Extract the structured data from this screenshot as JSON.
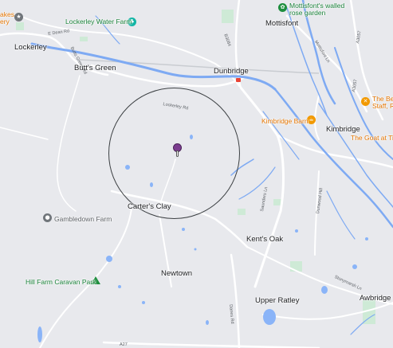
{
  "map": {
    "places": {
      "lockerley": "Lockerley",
      "butts_green": "Butt's Green",
      "dunbridge": "Dunbridge",
      "mottisfont": "Mottisfont",
      "kimbridge": "Kimbridge",
      "carters_clay": "Carter's Clay",
      "kents_oak": "Kent's Oak",
      "newtown": "Newtown",
      "upper_ratley": "Upper Ratley",
      "awbridge": "Awbridge"
    },
    "pois": {
      "lakes_line1": "akes",
      "lakes_line2": "ery",
      "lockerley_water_farm": "Lockerley Water Farm",
      "mottisfont_walled_line1": "Mottisfont's walled",
      "mottisfont_walled_line2": "rose garden",
      "kimbridge_barn": "Kimbridge Barn",
      "the_bea_line1": "The Bea",
      "the_bea_line2": "Staff, R",
      "goat_at_tin": "The Goat at Tin",
      "gambledown_farm": "Gambledown Farm",
      "hill_farm": "Hill Farm Caravan Park"
    },
    "roads": {
      "e_dean_rd": "E Dean Rd",
      "butts_green_rd": "Butts Green Rd",
      "lockerley_rd": "Lockerley Rd",
      "b3084": "B3084",
      "mottisfont_ln": "Mottisfont Ln",
      "a3057_top": "A3057",
      "a3057_right": "A3057",
      "saunders_ln": "Saunders Ln",
      "dunwood_hill": "Dunwood Hill",
      "danes_rd": "Danes Rd",
      "a27": "A27",
      "stonymarsh_ln": "Stonymarsh Ln"
    },
    "icons": {
      "lakes": "landmark-icon",
      "lockerley_water_farm": "tree-icon",
      "mottisfont_walled": "garden-icon",
      "kimbridge_barn": "cafe-icon",
      "the_bea": "restaurant-icon",
      "gambledown_farm": "pin-icon",
      "hill_farm": "campground-icon",
      "dunbridge_station": "train-icon"
    },
    "colors": {
      "land": "#e8e9ed",
      "water": "#8ab4f8",
      "river": "#7eaaf3",
      "road": "#ffffff",
      "park": "#ceead6",
      "radius_circle": "#3c4043",
      "marker": "#7b3c8f",
      "poi_green": "#1e8e3e",
      "poi_orange": "#f29900"
    }
  }
}
